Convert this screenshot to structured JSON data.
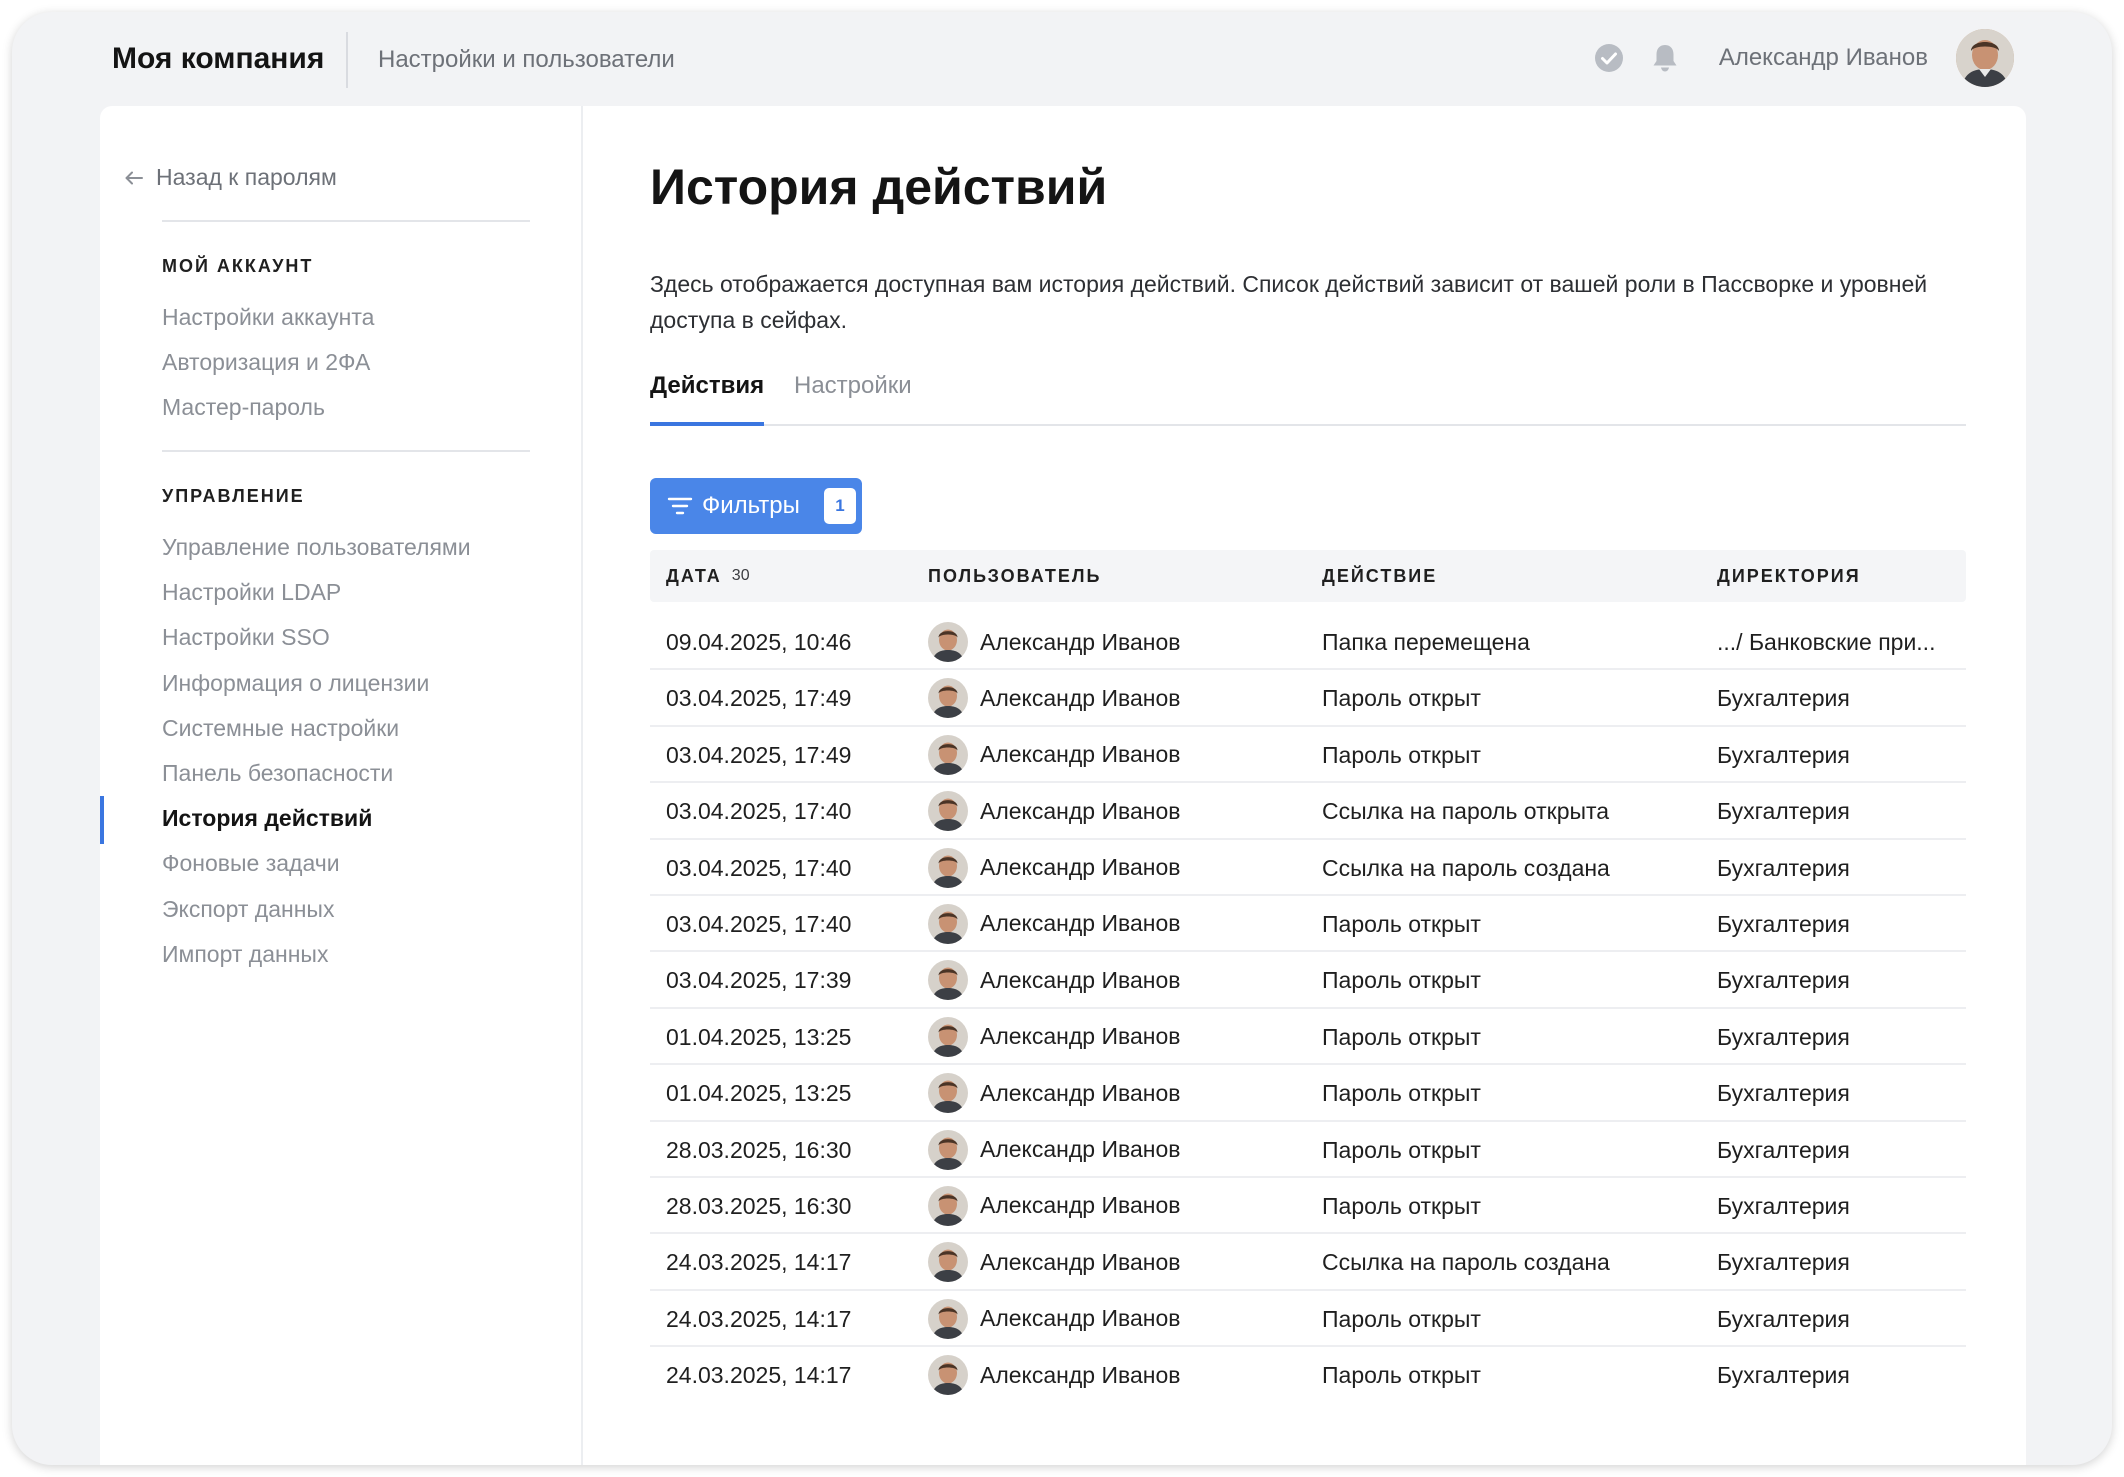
{
  "header": {
    "brand": "Моя компания",
    "section": "Настройки и пользователи",
    "icons": [
      "check-circle-icon",
      "bell-icon"
    ],
    "user_name": "Александр Иванов"
  },
  "sidebar": {
    "back_label": "Назад к паролям",
    "group1": {
      "heading": "МОЙ АККАУНТ",
      "items": [
        "Настройки аккаунта",
        "Авторизация и 2ФА",
        "Мастер-пароль"
      ]
    },
    "group2": {
      "heading": "УПРАВЛЕНИЕ",
      "items": [
        "Управление пользователями",
        "Настройки LDAP",
        "Настройки SSO",
        "Информация о лицензии",
        "Системные настройки",
        "Панель безопасности",
        "История действий",
        "Фоновые задачи",
        "Экспорт данных",
        "Импорт данных"
      ],
      "active": "История действий"
    }
  },
  "main": {
    "title": "История действий",
    "description": "Здесь отображается доступная вам история действий. Список действий зависит от вашей роли в Пассворке и уровней доступа в сейфах.",
    "tabs": [
      "Действия",
      "Настройки"
    ],
    "active_tab": "Действия",
    "filter": {
      "label": "Фильтры",
      "badge": "1"
    },
    "table": {
      "headers": {
        "date": "ДАТА",
        "date_count": "30",
        "user": "ПОЛЬЗОВАТЕЛЬ",
        "action": "ДЕЙСТВИЕ",
        "directory": "ДИРЕКТОРИЯ"
      },
      "rows": [
        {
          "date": "09.04.2025, 10:46",
          "user": "Александр Иванов",
          "action": "Папка перемещена",
          "directory": ".../ Банковские при..."
        },
        {
          "date": "03.04.2025, 17:49",
          "user": "Александр Иванов",
          "action": "Пароль открыт",
          "directory": "Бухгалтерия"
        },
        {
          "date": "03.04.2025, 17:49",
          "user": "Александр Иванов",
          "action": "Пароль открыт",
          "directory": "Бухгалтерия"
        },
        {
          "date": "03.04.2025, 17:40",
          "user": "Александр Иванов",
          "action": "Ссылка на пароль открыта",
          "directory": "Бухгалтерия"
        },
        {
          "date": "03.04.2025, 17:40",
          "user": "Александр Иванов",
          "action": "Ссылка на пароль создана",
          "directory": "Бухгалтерия"
        },
        {
          "date": "03.04.2025, 17:40",
          "user": "Александр Иванов",
          "action": "Пароль открыт",
          "directory": "Бухгалтерия"
        },
        {
          "date": "03.04.2025, 17:39",
          "user": "Александр Иванов",
          "action": "Пароль открыт",
          "directory": "Бухгалтерия"
        },
        {
          "date": "01.04.2025, 13:25",
          "user": "Александр Иванов",
          "action": "Пароль открыт",
          "directory": "Бухгалтерия"
        },
        {
          "date": "01.04.2025, 13:25",
          "user": "Александр Иванов",
          "action": "Пароль открыт",
          "directory": "Бухгалтерия"
        },
        {
          "date": "28.03.2025, 16:30",
          "user": "Александр Иванов",
          "action": "Пароль открыт",
          "directory": "Бухгалтерия"
        },
        {
          "date": "28.03.2025, 16:30",
          "user": "Александр Иванов",
          "action": "Пароль открыт",
          "directory": "Бухгалтерия"
        },
        {
          "date": "24.03.2025, 14:17",
          "user": "Александр Иванов",
          "action": "Ссылка на пароль создана",
          "directory": "Бухгалтерия"
        },
        {
          "date": "24.03.2025, 14:17",
          "user": "Александр Иванов",
          "action": "Пароль открыт",
          "directory": "Бухгалтерия"
        },
        {
          "date": "24.03.2025, 14:17",
          "user": "Александр Иванов",
          "action": "Пароль открыт",
          "directory": "Бухгалтерия"
        }
      ]
    }
  },
  "colors": {
    "accent": "#4a86e8",
    "active_bar": "#3a76e0",
    "background": "#f2f3f5"
  }
}
